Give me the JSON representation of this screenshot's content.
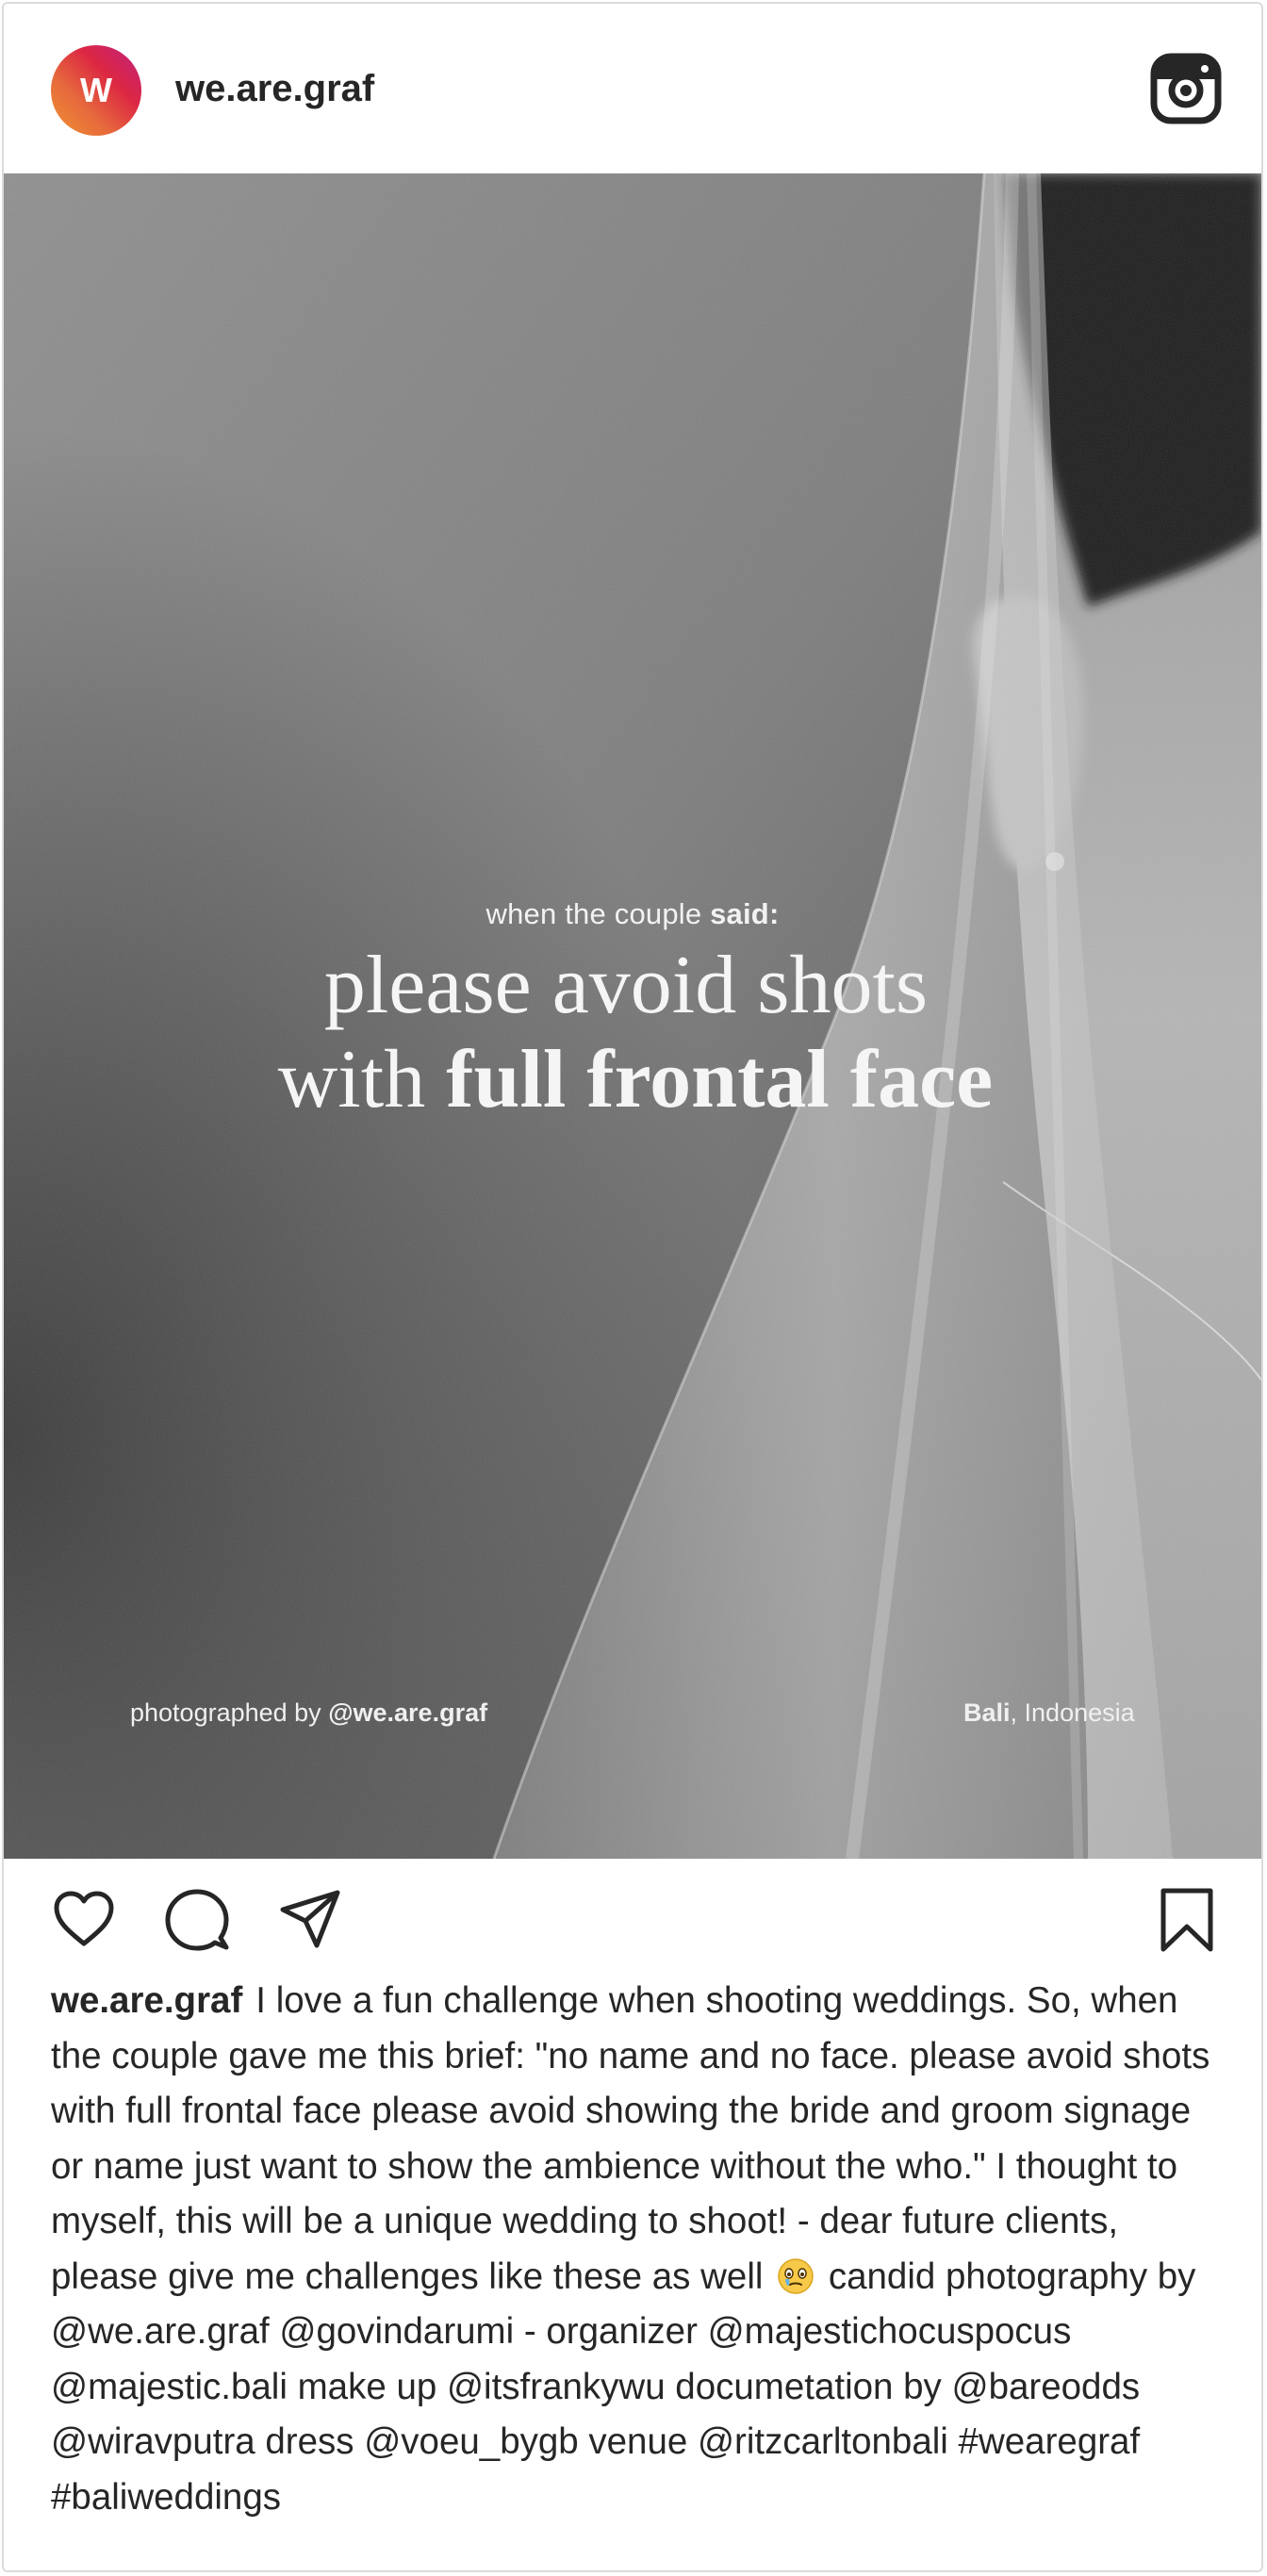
{
  "post": {
    "avatar_initial": "W",
    "username": "we.are.graf",
    "header_icon": "instagram-logo-icon"
  },
  "photo": {
    "overlay_intro_plain": "when the couple ",
    "overlay_intro_bold": "said:",
    "overlay_line1": "please avoid shots",
    "overlay_line2_plain": "with ",
    "overlay_line2_bold": "full frontal face",
    "credit_plain": "photographed by ",
    "credit_bold": "@we.are.graf",
    "location_bold": "Bali",
    "location_plain": ", Indonesia",
    "style": "black-and-white portrait, veil over bride's ear"
  },
  "actions": {
    "like_icon": "heart-icon",
    "comment_icon": "comment-bubble-icon",
    "share_icon": "paper-plane-icon",
    "save_icon": "bookmark-icon"
  },
  "caption": {
    "username": "we.are.graf",
    "text_before_emoji": "I love a fun challenge when shooting weddings. So, when the couple gave me this brief: \"no name and no face. please avoid shots with full frontal face please avoid showing the bride and groom signage or name just want to show the ambience without the who.\" I thought to myself, this will be a unique wedding to shoot! - dear future clients, please give me challenges like these as well",
    "emoji": "teary-smile-emoji-icon",
    "text_after_emoji": "candid photography by @we.are.graf @govindarumi - organizer @majestichocuspocus @majestic.bali make up @itsfrankywu documetation by @bareodds @wiravputra dress @voeu_bygb venue @ritzcarltonbali #wearegraf #baliweddings"
  },
  "colors": {
    "text": "#262626",
    "border": "#dbdbdb",
    "avatar_gradient": [
      "#f09433",
      "#dc2743",
      "#bc1888"
    ]
  }
}
